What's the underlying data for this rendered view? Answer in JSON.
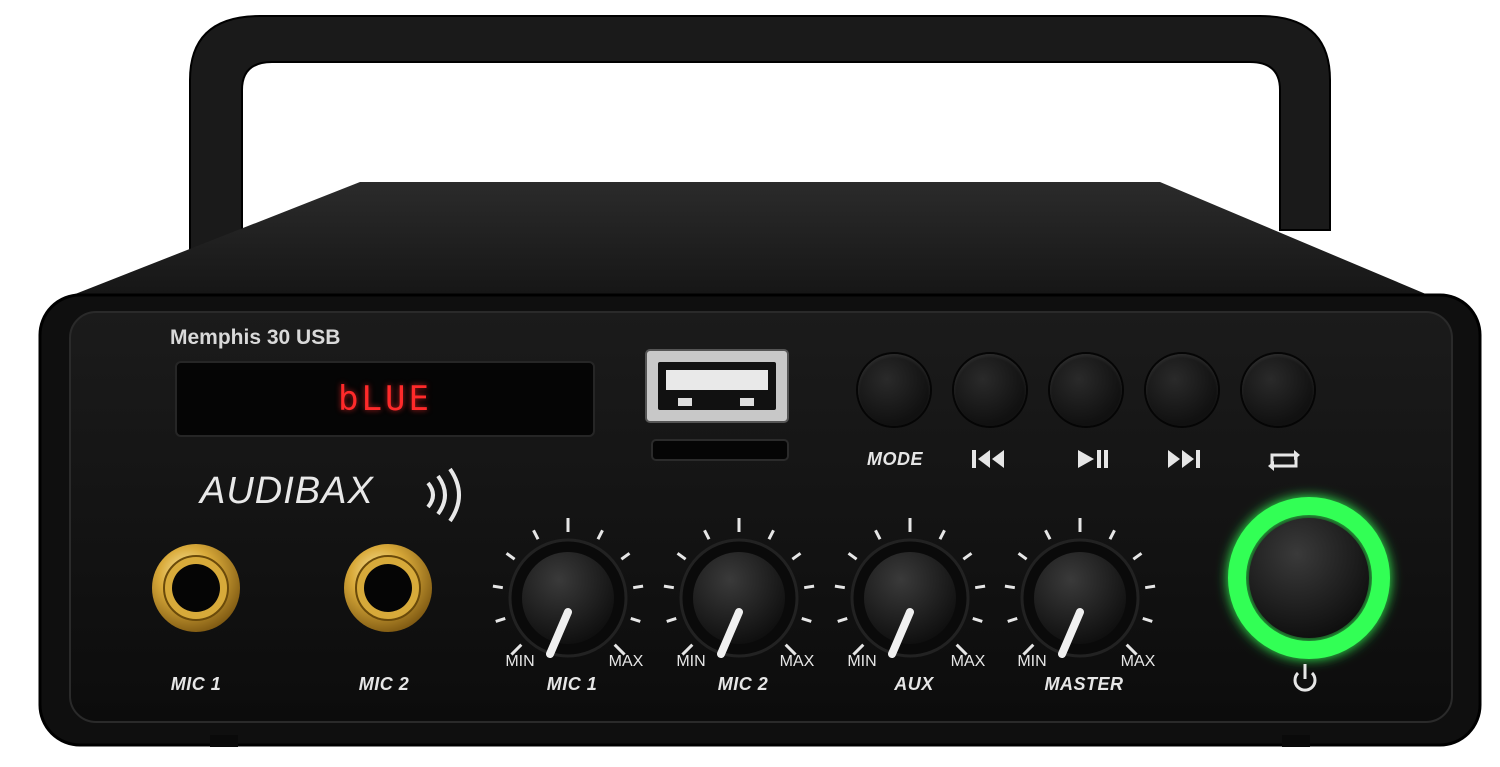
{
  "device": {
    "model": "Memphis 30 USB",
    "brand": "AUDIBAX",
    "display_text": "bLUE"
  },
  "inputs": {
    "mic1_label": "MIC 1",
    "mic2_label": "MIC 2"
  },
  "controls": {
    "mode_label": "MODE",
    "prev_icon": "skip-back-icon",
    "play_icon": "play-pause-icon",
    "next_icon": "skip-forward-icon",
    "repeat_icon": "repeat-icon",
    "power_icon": "power-icon"
  },
  "knobs": [
    {
      "label": "MIC 1",
      "min": "MIN",
      "max": "MAX"
    },
    {
      "label": "MIC 2",
      "min": "MIN",
      "max": "MAX"
    },
    {
      "label": "AUX",
      "min": "MIN",
      "max": "MAX"
    },
    {
      "label": "MASTER",
      "min": "MIN",
      "max": "MAX"
    }
  ],
  "colors": {
    "display": "#ff2a2a",
    "power_ring": "#33ff55",
    "jack_gold": "#d4a83a"
  }
}
